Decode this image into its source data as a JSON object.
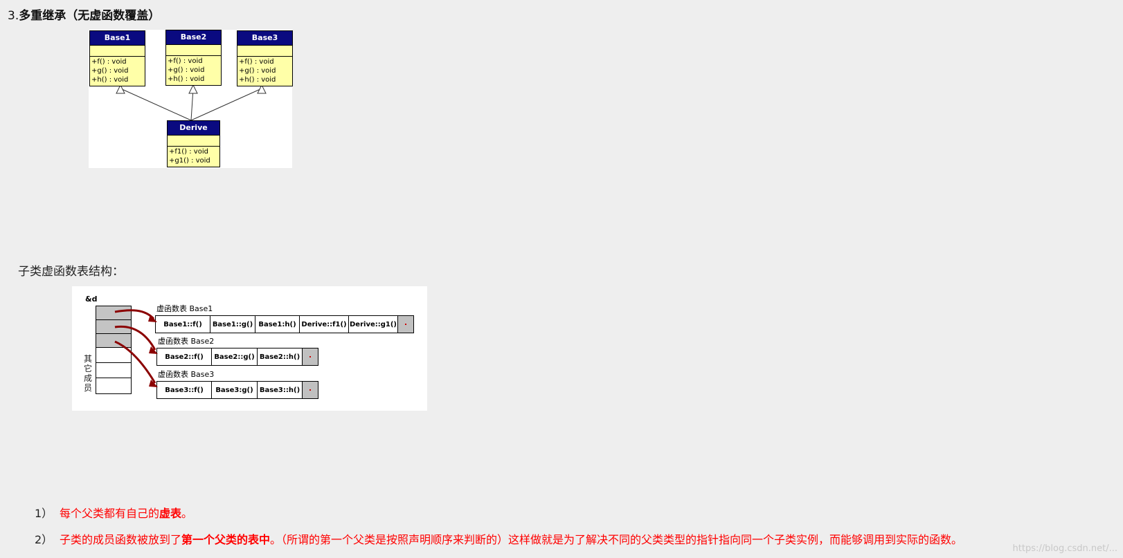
{
  "heading": {
    "number": "3.",
    "title": "多重继承（无虚函数覆盖）"
  },
  "uml": {
    "classes": [
      {
        "name": "Base1",
        "ops": [
          "+f() : void",
          "+g() : void",
          "+h() : void"
        ]
      },
      {
        "name": "Base2",
        "ops": [
          "+f() : void",
          "+g() : void",
          "+h() : void"
        ]
      },
      {
        "name": "Base3",
        "ops": [
          "+f() : void",
          "+g() : void",
          "+h() : void"
        ]
      },
      {
        "name": "Derive",
        "ops": [
          "+f1() : void",
          "+g1() : void"
        ]
      }
    ]
  },
  "subheading": "子类虚函数表结构：",
  "vtable": {
    "object_label": "&d",
    "other_members": [
      "其",
      "它",
      "成",
      "员"
    ],
    "tables": [
      {
        "label": "虚函数表 Base1",
        "cells": [
          "Base1::f()",
          "Base1::g()",
          "Base1:h()",
          "Derive::f1()",
          "Derive::g1()"
        ]
      },
      {
        "label": "虚函数表 Base2",
        "cells": [
          "Base2::f()",
          "Base2::g()",
          "Base2::h()"
        ]
      },
      {
        "label": "虚函数表 Base3",
        "cells": [
          "Base3::f()",
          "Base3:g()",
          "Base3::h()"
        ]
      }
    ],
    "colors": {
      "arrow": "#8b0000",
      "slot": "#c4c4c4"
    }
  },
  "notes": [
    {
      "index": "1）",
      "text_a": "每个父类都有自己的",
      "bold": "虚表",
      "text_b": "。"
    },
    {
      "index": "2）",
      "text_a": "子类的成员函数被放到了",
      "bold": "第一个父类的表中",
      "text_b": "。（所谓的第一个父类是按照声明顺序来判断的）这样做就是为了解决不同的父类类型的指针指向同一个子类实例，而能够调用到实际的函数。"
    }
  ],
  "watermark": "https://blog.csdn.net/..."
}
